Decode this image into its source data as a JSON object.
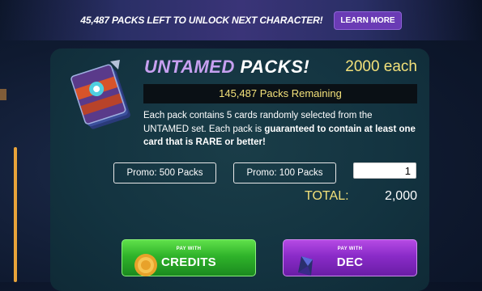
{
  "banner": {
    "text": "45,487 PACKS LEFT TO UNLOCK NEXT CHARACTER!",
    "button": "LEARN MORE"
  },
  "pack": {
    "title_part1": "UNTAMED",
    "title_part2": "PACKS!",
    "price": "2000 each",
    "remaining": "145,487 Packs Remaining",
    "desc_normal": "Each pack contains 5 cards randomly selected from the UNTAMED set. Each pack is ",
    "desc_bold": "guaranteed to contain at least one card that is RARE or better!"
  },
  "promos": {
    "promo1": "Promo: 500 Packs",
    "promo2": "Promo: 100 Packs"
  },
  "quantity": {
    "value": "1"
  },
  "total": {
    "label": "TOTAL:",
    "value": "2,000"
  },
  "pay": {
    "credits": {
      "with": "PAY WITH",
      "label": "CREDITS"
    },
    "dec": {
      "with": "PAY WITH",
      "label": "DEC"
    }
  },
  "colors": {
    "accent_gold": "#f3e17a",
    "title_purple": "#c7a0f0",
    "credits_green": "#2fb32a",
    "dec_purple": "#8a2bc8"
  },
  "icons": {
    "pack": "card-pack-icon",
    "coin": "credits-coin-icon",
    "gem": "dec-gem-icon"
  }
}
